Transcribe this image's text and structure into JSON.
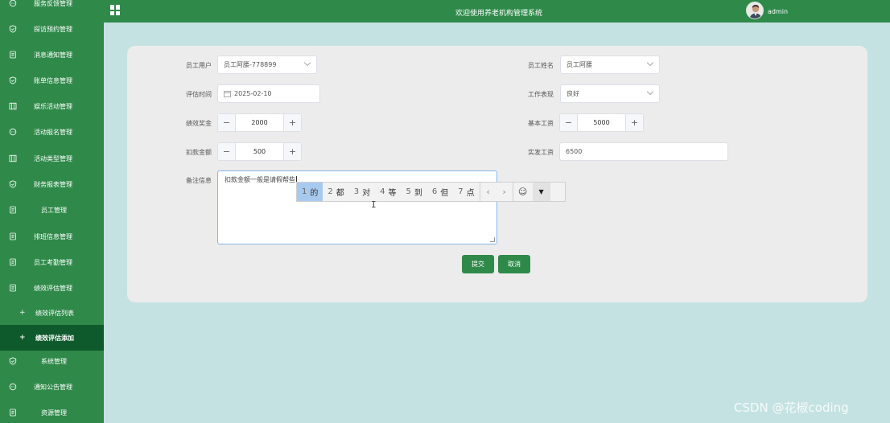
{
  "topbar": {
    "title": "欢迎使用养老机构管理系统",
    "user": "admin"
  },
  "sidebar": {
    "items": [
      {
        "label": "服务反馈管理",
        "icon": "chat-icon"
      },
      {
        "label": "探访预约管理",
        "icon": "shield-check-icon"
      },
      {
        "label": "消息通知管理",
        "icon": "document-icon"
      },
      {
        "label": "账单信息管理",
        "icon": "shield-check-icon"
      },
      {
        "label": "娱乐活动管理",
        "icon": "columns-icon"
      },
      {
        "label": "活动报名管理",
        "icon": "chat-icon"
      },
      {
        "label": "活动类型管理",
        "icon": "columns-icon"
      },
      {
        "label": "财务报表管理",
        "icon": "shield-check-icon"
      },
      {
        "label": "员工管理",
        "icon": "document-icon"
      },
      {
        "label": "排班信息管理",
        "icon": "document-icon"
      },
      {
        "label": "员工考勤管理",
        "icon": "document-icon"
      },
      {
        "label": "绩效评估管理",
        "icon": "document-icon"
      },
      {
        "label": "绩效评估列表",
        "icon": "plus-icon"
      },
      {
        "label": "绩效评估添加",
        "icon": "plus-icon"
      },
      {
        "label": "系统管理",
        "icon": "shield-check-icon"
      },
      {
        "label": "通知公告管理",
        "icon": "chat-icon"
      },
      {
        "label": "资源管理",
        "icon": "document-icon"
      }
    ]
  },
  "form": {
    "employee_user_label": "员工用户",
    "employee_user_value": "员工阿腰-778899",
    "employee_name_label": "员工姓名",
    "employee_name_value": "员工阿腰",
    "eval_time_label": "评估时间",
    "eval_time_value": "2025-02-10",
    "performance_label": "工作表现",
    "performance_value": "良好",
    "bonus_label": "绩效奖金",
    "bonus_value": "2000",
    "base_salary_label": "基本工资",
    "base_salary_value": "5000",
    "deduction_label": "扣款金额",
    "deduction_value": "500",
    "actual_salary_label": "实发工资",
    "actual_salary_value": "6500",
    "remark_label": "备注信息",
    "remark_value": "扣款金额一般是请假帮些",
    "stepper_minus": "−",
    "stepper_plus": "+",
    "submit_label": "提交",
    "cancel_label": "取消"
  },
  "ime": {
    "candidates": [
      {
        "num": "1",
        "text": "的"
      },
      {
        "num": "2",
        "text": "都"
      },
      {
        "num": "3",
        "text": "对"
      },
      {
        "num": "4",
        "text": "等"
      },
      {
        "num": "5",
        "text": "到"
      },
      {
        "num": "6",
        "text": "但"
      },
      {
        "num": "7",
        "text": "点"
      }
    ],
    "prev": "‹",
    "next": "›",
    "emoji": "☺",
    "more": "▼"
  },
  "watermark": "CSDN @花椒coding",
  "colors": {
    "sidebar": "#2f8a4a",
    "sidebar_active": "#0f5a2c",
    "background": "#c4e2e2",
    "card": "#ececec",
    "button": "#2f8a4a"
  }
}
